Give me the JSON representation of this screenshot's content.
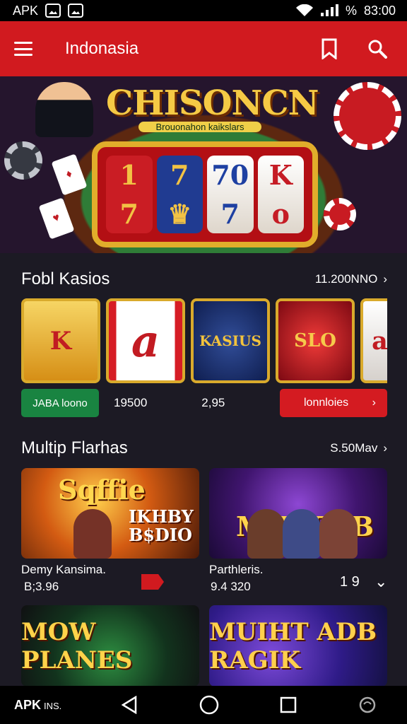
{
  "status": {
    "brand": "APK",
    "time": "83:00"
  },
  "app_bar": {
    "title": "Indonasia"
  },
  "banner": {
    "title": "CHISONCN",
    "subtitle": "Brouonahon kaikslars"
  },
  "section_one": {
    "title": "Fobl Kasios",
    "link": "11.200NNO",
    "tiles": [
      {
        "label": "K"
      },
      {
        "label": "a"
      },
      {
        "label": "KASIUS"
      },
      {
        "label": "SLO"
      },
      {
        "label": "a"
      }
    ],
    "stats": {
      "pill": "JABA loono",
      "value_one": "19500",
      "value_two": "2,95",
      "button": "lonnloies"
    }
  },
  "section_two": {
    "title": "Multip Flarhas",
    "link": "S.50Mav",
    "cards": [
      {
        "art_title": "Sqffie",
        "art_sub": "IKHBY B$DIO",
        "caption": "Demy Kansima.",
        "value": "B;3.96"
      },
      {
        "art_title": "MIJLEAB",
        "caption": "Parthleris.",
        "value": "9.4 320",
        "meta": "1 9"
      }
    ],
    "bottom": [
      {
        "art_title": "MOW PLANES"
      },
      {
        "art_title": "MUIHT ADB RAGIK"
      }
    ]
  },
  "navigation": {
    "brand": "APK",
    "suffix": "INS."
  },
  "colors": {
    "primary": "#d11a1f",
    "background": "#1c1a24",
    "gold": "#f2c244",
    "green": "#198441"
  }
}
